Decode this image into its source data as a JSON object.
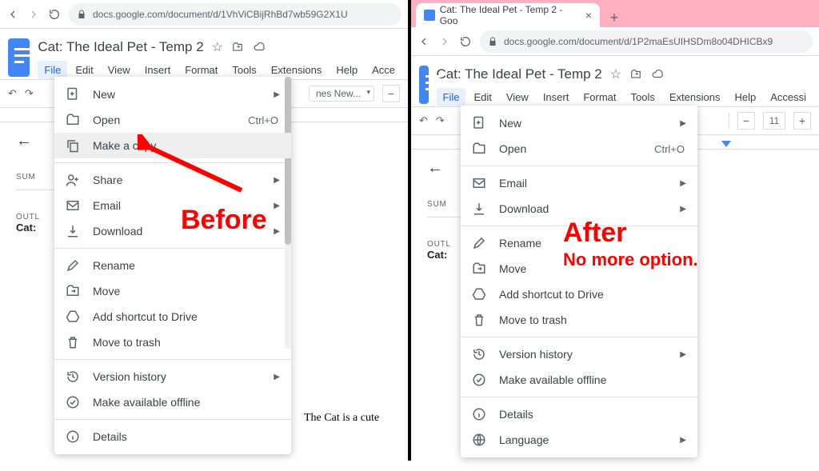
{
  "doc": {
    "title": "Cat: The Ideal Pet - Temp 2",
    "body_snippet": "The Cat is a cute",
    "tab_title": "Cat: The Ideal Pet - Temp 2 - Goo"
  },
  "browser": {
    "url_before": "docs.google.com/document/d/1VhViCBijRhBd7wb59G2X1U",
    "url_after": "docs.google.com/document/d/1P2maEsUIHSDm8o04DHICBx9"
  },
  "menubar": [
    "File",
    "Edit",
    "View",
    "Insert",
    "Format",
    "Tools",
    "Extensions",
    "Help",
    "Acce"
  ],
  "menubar_right": [
    "File",
    "Edit",
    "View",
    "Insert",
    "Format",
    "Tools",
    "Extensions",
    "Help",
    "Accessi"
  ],
  "toolbar": {
    "font": "nes New...",
    "size": "11"
  },
  "outline": {
    "summary": "SUM",
    "outline_label": "OUTL",
    "heading": "Cat:"
  },
  "menu_before": {
    "groups": [
      [
        {
          "icon": "plus-doc-icon",
          "label": "New",
          "submenu": true
        },
        {
          "icon": "folder-icon",
          "label": "Open",
          "shortcut": "Ctrl+O"
        },
        {
          "icon": "copy-icon",
          "label": "Make a copy",
          "highlight": true
        }
      ],
      [
        {
          "icon": "person-plus-icon",
          "label": "Share",
          "submenu": true
        },
        {
          "icon": "mail-icon",
          "label": "Email",
          "submenu": true
        },
        {
          "icon": "download-icon",
          "label": "Download",
          "submenu": true
        }
      ],
      [
        {
          "icon": "pencil-icon",
          "label": "Rename"
        },
        {
          "icon": "move-folder-icon",
          "label": "Move"
        },
        {
          "icon": "drive-shortcut-icon",
          "label": "Add shortcut to Drive"
        },
        {
          "icon": "trash-icon",
          "label": "Move to trash"
        }
      ],
      [
        {
          "icon": "history-icon",
          "label": "Version history",
          "submenu": true
        },
        {
          "icon": "offline-icon",
          "label": "Make available offline"
        }
      ],
      [
        {
          "icon": "info-icon",
          "label": "Details"
        }
      ]
    ]
  },
  "menu_after": {
    "groups": [
      [
        {
          "icon": "plus-doc-icon",
          "label": "New",
          "submenu": true
        },
        {
          "icon": "folder-icon",
          "label": "Open",
          "shortcut": "Ctrl+O"
        }
      ],
      [
        {
          "icon": "mail-icon",
          "label": "Email",
          "submenu": true
        },
        {
          "icon": "download-icon",
          "label": "Download",
          "submenu": true
        }
      ],
      [
        {
          "icon": "pencil-icon",
          "label": "Rename"
        },
        {
          "icon": "move-folder-icon",
          "label": "Move"
        },
        {
          "icon": "drive-shortcut-icon",
          "label": "Add shortcut to Drive"
        },
        {
          "icon": "trash-icon",
          "label": "Move to trash"
        }
      ],
      [
        {
          "icon": "history-icon",
          "label": "Version history",
          "submenu": true
        },
        {
          "icon": "offline-icon",
          "label": "Make available offline"
        }
      ],
      [
        {
          "icon": "info-icon",
          "label": "Details"
        },
        {
          "icon": "globe-icon",
          "label": "Language",
          "submenu": true
        }
      ]
    ]
  },
  "annotations": {
    "before": "Before",
    "after": "After",
    "after_sub": "No more option."
  }
}
